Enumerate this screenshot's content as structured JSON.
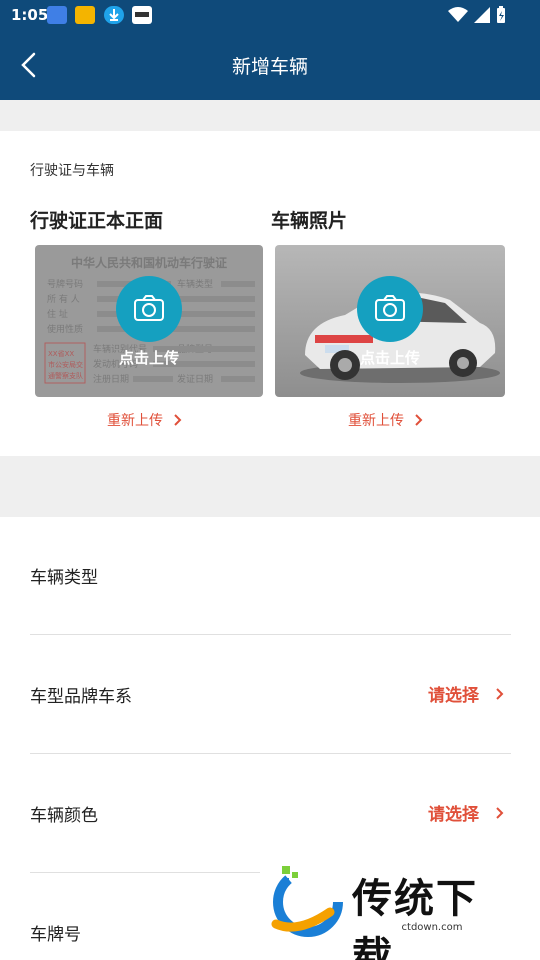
{
  "status_bar": {
    "time": "1:05"
  },
  "app_bar": {
    "title": "新增车辆"
  },
  "license_section": {
    "label": "行驶证与车辆",
    "license": {
      "title": "行驶证正本正面",
      "upload_text": "点击上传",
      "reupload_text": "重新上传",
      "image_text": {
        "heading": "中华人民共和国机动车行驶证",
        "fields_left": [
          "号牌号码",
          "所 有 人",
          "住    址",
          "使用性质",
          "车辆识别代号",
          "发动机号码",
          "注册日期"
        ],
        "fields_right": [
          "车辆类型",
          "品牌型号",
          "发证日期"
        ],
        "stamp": [
          "XX省XX",
          "市公安局交",
          "通警察支队"
        ]
      }
    },
    "vehicle": {
      "title": "车辆照片",
      "upload_text": "点击上传",
      "reupload_text": "重新上传"
    }
  },
  "form": {
    "rows": [
      {
        "label": "车辆类型",
        "value": ""
      },
      {
        "label": "车型品牌车系",
        "value": "请选择"
      },
      {
        "label": "车辆颜色",
        "value": "请选择"
      },
      {
        "label": "车牌号",
        "value": ""
      }
    ]
  },
  "watermark": {
    "title": "传统下载",
    "url": "ctdown.com"
  },
  "colors": {
    "primary": "#0f4a7a",
    "accent": "#e0503a",
    "camera": "#15a0c0"
  }
}
